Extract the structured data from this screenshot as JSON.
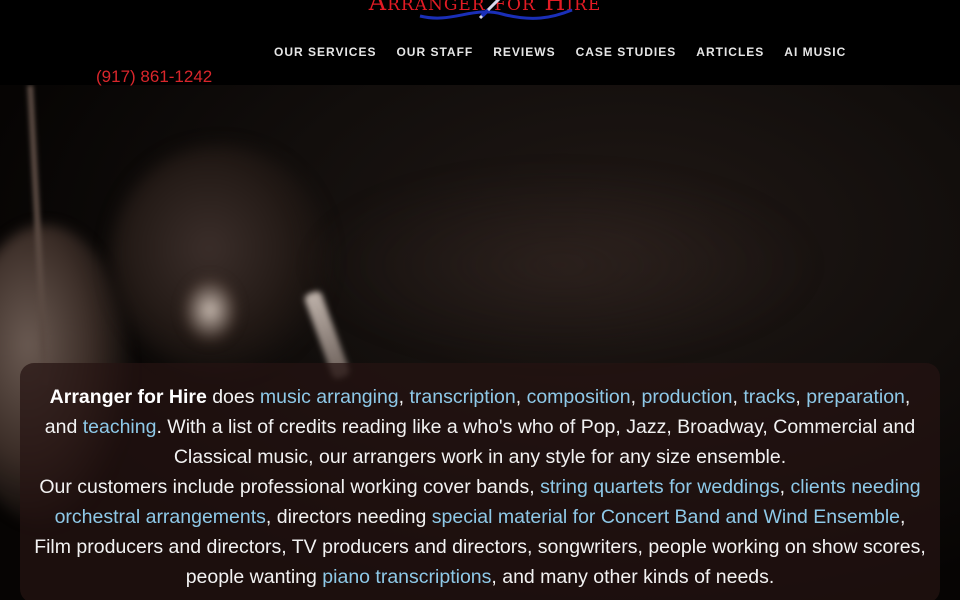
{
  "header": {
    "logo_text": "Arranger for Hire",
    "phone": "(917) 861-1242",
    "nav": [
      {
        "label": "OUR SERVICES"
      },
      {
        "label": "OUR STAFF"
      },
      {
        "label": "REVIEWS"
      },
      {
        "label": "CASE STUDIES"
      },
      {
        "label": "ARTICLES"
      },
      {
        "label": "AI MUSIC"
      }
    ]
  },
  "intro": {
    "brand": "Arranger for Hire",
    "t1": " does ",
    "link_music_arranging": "music arranging",
    "sep1": ", ",
    "link_transcription": "transcription",
    "sep2": ", ",
    "link_composition": "composition",
    "sep3": ", ",
    "link_production": "production",
    "sep4": ", ",
    "link_tracks": "tracks",
    "sep5": ", ",
    "link_preparation": "preparation",
    "t2": ", and ",
    "link_teaching": "teaching",
    "t3": ". With a list of credits reading like a who's who of Pop, Jazz, Broadway, Commercial and Classical music, our arrangers work in any style for any size ensemble."
  },
  "customers": {
    "t1": "Our customers include professional working cover bands, ",
    "link_string_quartets": "string quartets for weddings",
    "sep1": ", ",
    "link_orchestral": "clients needing orchestral arrangements",
    "t2": ", directors needing ",
    "link_special_material": "special material for Concert Band and Wind Ensemble",
    "t3": ", Film producers and directors, TV producers and directors, songwriters, people working on show scores, people wanting ",
    "link_piano": "piano transcriptions",
    "t4": ", and many other kinds of needs."
  },
  "colors": {
    "accent_red": "#d9262b",
    "link_blue": "#8ec9e8",
    "background": "#000000"
  }
}
